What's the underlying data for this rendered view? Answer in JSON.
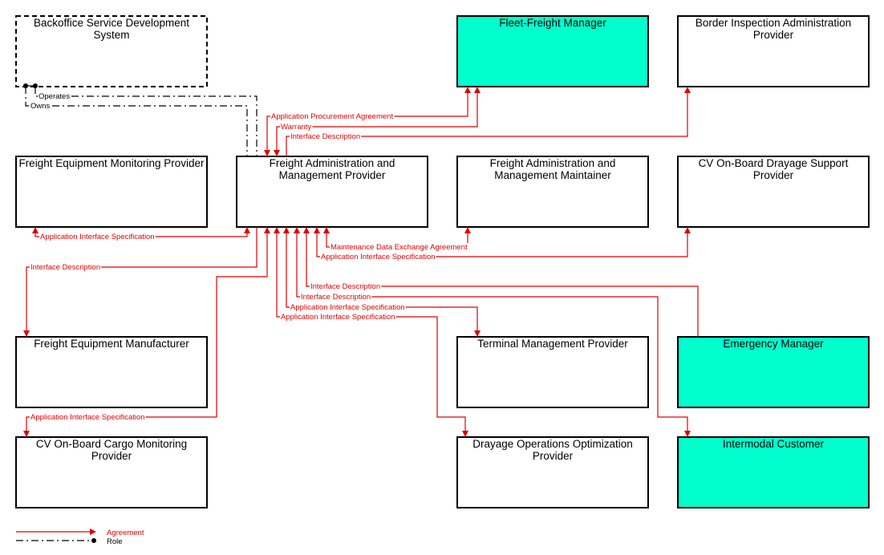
{
  "colors": {
    "agreement": "#e00000",
    "role": "#000000",
    "highlight_box": "#00ffcc",
    "box": "#ffffff"
  },
  "boxes": [
    {
      "id": "backoffice",
      "lines": [
        "Backoffice Service Development",
        "System"
      ],
      "dashed": true
    },
    {
      "id": "fleet",
      "lines": [
        "Fleet-Freight Manager"
      ],
      "teal": true
    },
    {
      "id": "border",
      "lines": [
        "Border Inspection Administration",
        "Provider"
      ]
    },
    {
      "id": "fem",
      "lines": [
        "Freight Equipment Monitoring Provider"
      ]
    },
    {
      "id": "famp",
      "lines": [
        "Freight Administration and",
        "Management Provider"
      ]
    },
    {
      "id": "famm",
      "lines": [
        "Freight Administration and",
        "Management Maintainer"
      ]
    },
    {
      "id": "cvdray",
      "lines": [
        "CV On-Board Drayage Support",
        "Provider"
      ]
    },
    {
      "id": "femfr",
      "lines": [
        "Freight Equipment Manufacturer"
      ]
    },
    {
      "id": "terminal",
      "lines": [
        "Terminal Management Provider"
      ]
    },
    {
      "id": "emergency",
      "lines": [
        "Emergency Manager"
      ],
      "teal": true
    },
    {
      "id": "cvcargo",
      "lines": [
        "CV On-Board Cargo Monitoring",
        "Provider"
      ]
    },
    {
      "id": "drayage",
      "lines": [
        "Drayage Operations Optimization",
        "Provider"
      ]
    },
    {
      "id": "intermodal",
      "lines": [
        "Intermodal Customer"
      ],
      "teal": true
    }
  ],
  "flows": [
    {
      "label": "Application Procurement Agreement"
    },
    {
      "label": "Warranty"
    },
    {
      "label": "Interface Description"
    },
    {
      "label": "Application Interface Specification"
    },
    {
      "label": "Interface Description"
    },
    {
      "label": "Application Interface Specification"
    },
    {
      "label": "Application Interface Specification"
    },
    {
      "label": "Application Interface Specification"
    },
    {
      "label": "Interface Description"
    },
    {
      "label": "Interface Description"
    },
    {
      "label": "Application Interface Specification"
    },
    {
      "label": "Maintenance Data Exchange Agreement"
    }
  ],
  "roles": [
    {
      "label": "Operates"
    },
    {
      "label": "Owns"
    }
  ],
  "legend": {
    "agreement": "Agreement",
    "role": "Role"
  }
}
